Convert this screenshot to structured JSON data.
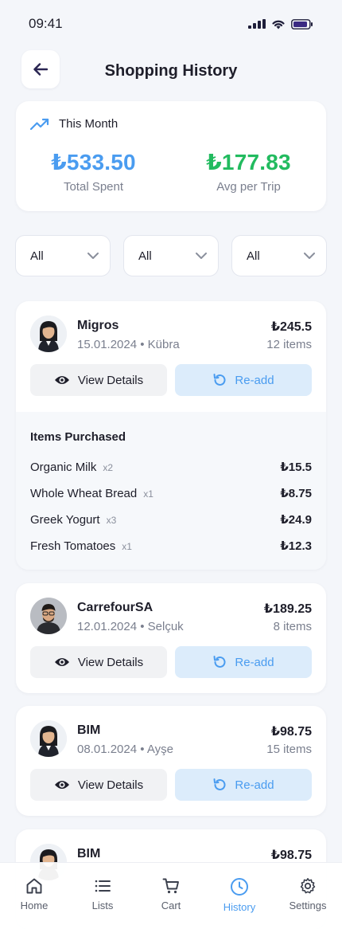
{
  "status_bar": {
    "time": "09:41"
  },
  "header": {
    "title": "Shopping History"
  },
  "summary": {
    "period_label": "This Month",
    "total_spent_value": "₺533.50",
    "total_spent_label": "Total Spent",
    "avg_value": "₺177.83",
    "avg_label": "Avg per Trip",
    "colors": {
      "total": "#4a9cf0",
      "avg": "#22bb5f",
      "trend_icon": "#4a9cf0"
    }
  },
  "filters": [
    {
      "selected": "All"
    },
    {
      "selected": "All"
    },
    {
      "selected": "All"
    }
  ],
  "trips": [
    {
      "store": "Migros",
      "date": "15.01.2024",
      "person": "Kübra",
      "meta": "15.01.2024 • Kübra",
      "amount": "₺245.5",
      "items_count": "12 items",
      "avatar": "woman-avatar",
      "view_label": "View Details",
      "readd_label": "Re-add",
      "expanded": true,
      "items_title": "Items Purchased",
      "items": [
        {
          "name": "Organic Milk",
          "qty": "x2",
          "price": "₺15.5"
        },
        {
          "name": "Whole Wheat Bread",
          "qty": "x1",
          "price": "₺8.75"
        },
        {
          "name": "Greek Yogurt",
          "qty": "x3",
          "price": "₺24.9"
        },
        {
          "name": "Fresh Tomatoes",
          "qty": "x1",
          "price": "₺12.3"
        }
      ]
    },
    {
      "store": "CarrefourSA",
      "meta": "12.01.2024 • Selçuk",
      "amount": "₺189.25",
      "items_count": "8 items",
      "avatar": "man-avatar",
      "view_label": "View Details",
      "readd_label": "Re-add"
    },
    {
      "store": "BIM",
      "meta": "08.01.2024 • Ayşe",
      "amount": "₺98.75",
      "items_count": "15 items",
      "avatar": "woman-avatar",
      "view_label": "View Details",
      "readd_label": "Re-add"
    },
    {
      "store": "BIM",
      "meta": "",
      "amount": "₺98.75",
      "items_count": "",
      "avatar": "woman-avatar",
      "view_label": "",
      "readd_label": ""
    }
  ],
  "nav": {
    "items": [
      {
        "label": "Home",
        "icon": "home-icon"
      },
      {
        "label": "Lists",
        "icon": "list-icon"
      },
      {
        "label": "Cart",
        "icon": "cart-icon"
      },
      {
        "label": "History",
        "icon": "clock-icon",
        "active": true
      },
      {
        "label": "Settings",
        "icon": "gear-icon"
      }
    ]
  },
  "colors": {
    "accent": "#4a9cf0",
    "success": "#22bb5f",
    "background": "#f4f6fa"
  }
}
